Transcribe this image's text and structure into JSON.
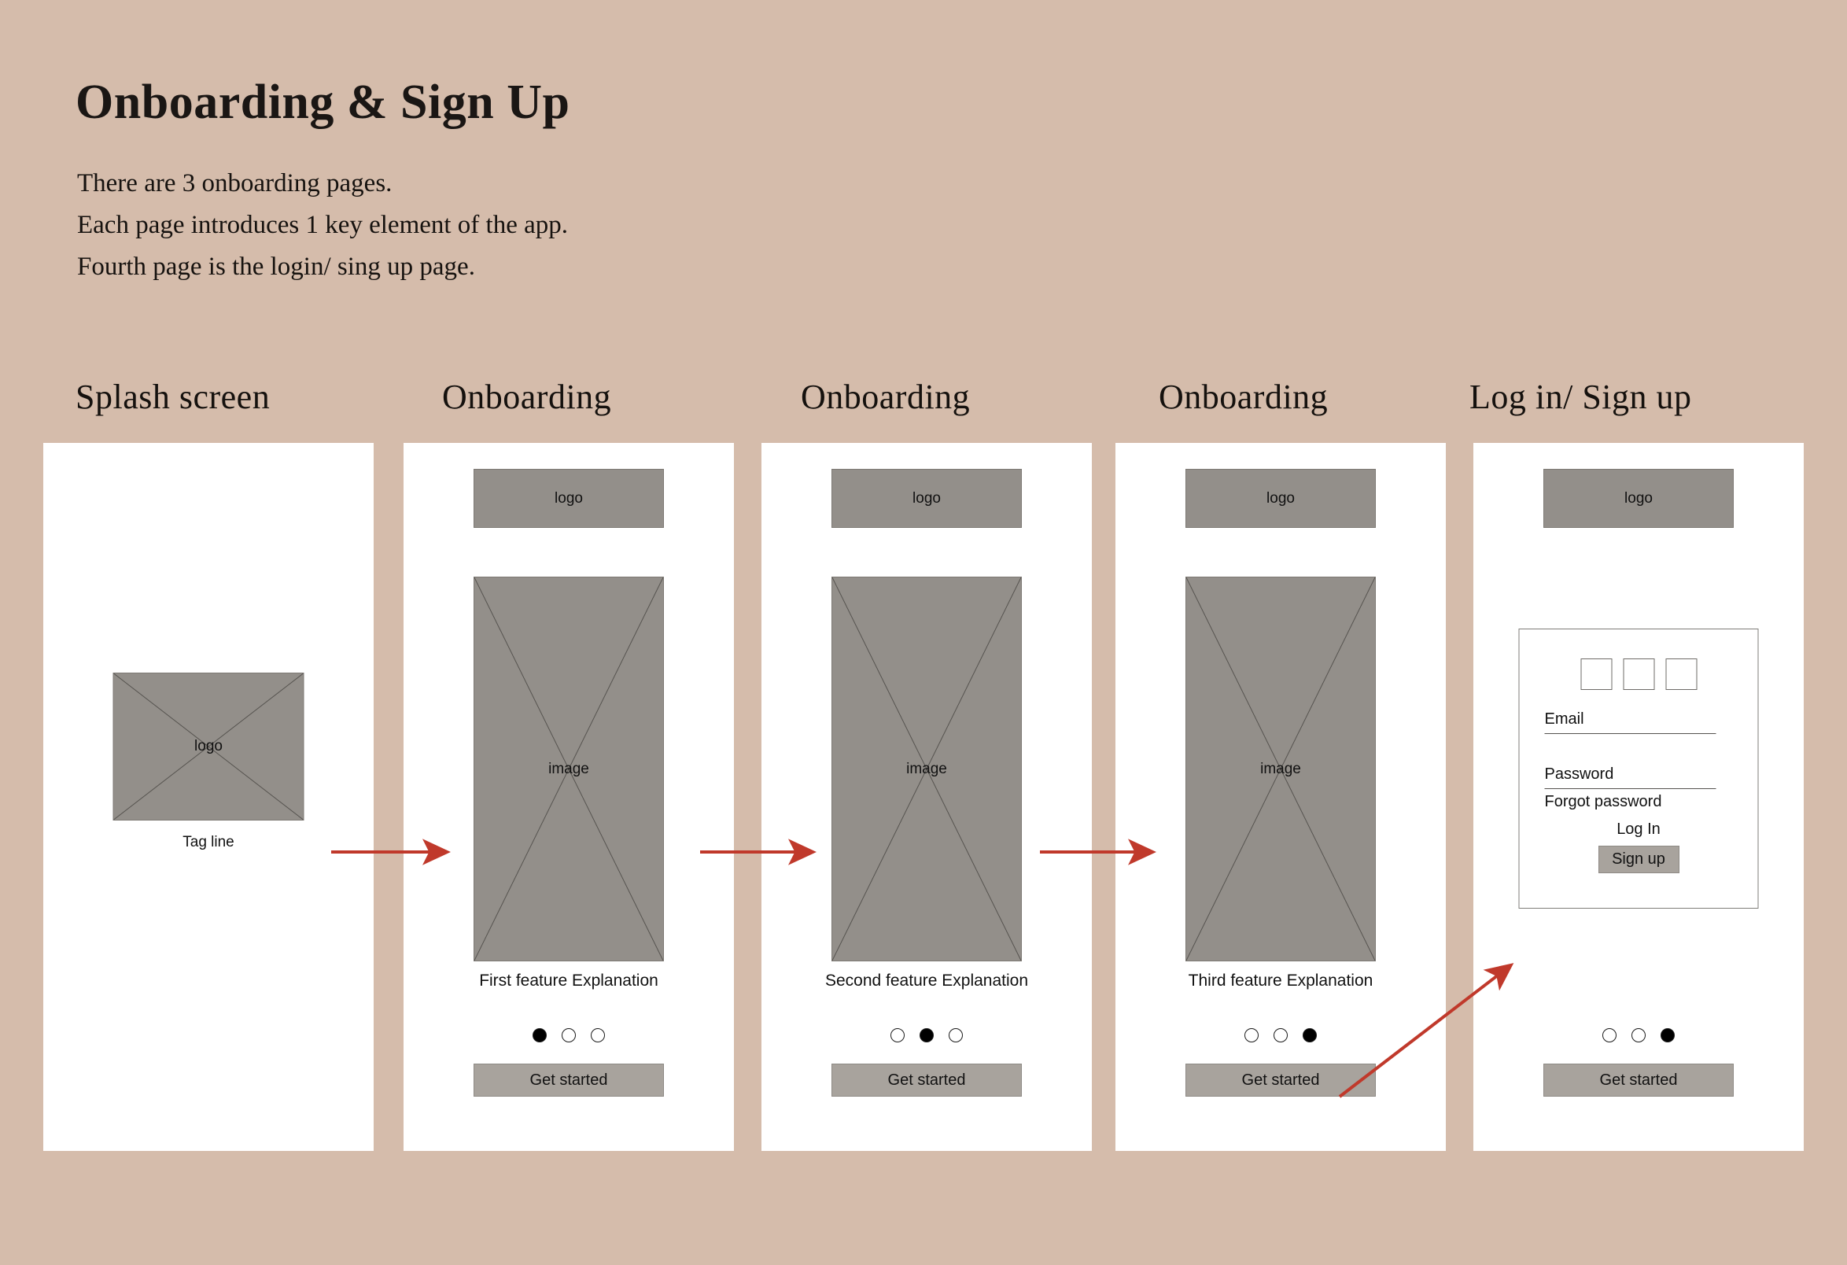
{
  "header": {
    "title": "Onboarding & Sign Up",
    "description_lines": [
      "There are 3 onboarding pages.",
      "Each page introduces 1 key element of the app.",
      "Fourth page is the login/ sing up page."
    ]
  },
  "colors": {
    "background": "#d5bcab",
    "card": "#ffffff",
    "placeholder_gray": "#938f8a",
    "button_gray": "#a8a39d",
    "arrow_red": "#c0392b",
    "text": "#111111"
  },
  "columns": [
    {
      "heading": "Splash screen"
    },
    {
      "heading": "Onboarding"
    },
    {
      "heading": "Onboarding"
    },
    {
      "heading": "Onboarding"
    },
    {
      "heading": "Log in/ Sign up"
    }
  ],
  "screens": {
    "splash": {
      "logo_label": "logo",
      "tagline": "Tag line"
    },
    "onboarding_1": {
      "logo_label": "logo",
      "image_label": "image",
      "feature_text": "First feature Explanation",
      "dots": [
        true,
        false,
        false
      ],
      "cta_label": "Get started"
    },
    "onboarding_2": {
      "logo_label": "logo",
      "image_label": "image",
      "feature_text": "Second feature Explanation",
      "dots": [
        false,
        true,
        false
      ],
      "cta_label": "Get started"
    },
    "onboarding_3": {
      "logo_label": "logo",
      "image_label": "image",
      "feature_text": "Third feature Explanation",
      "dots": [
        false,
        false,
        true
      ],
      "cta_label": "Get started"
    },
    "login": {
      "logo_label": "logo",
      "social_boxes": 3,
      "email_label": "Email",
      "password_label": "Password",
      "forgot_label": "Forgot password",
      "login_label": "Log In",
      "signup_label": "Sign up",
      "dots": [
        false,
        false,
        true
      ],
      "cta_label": "Get started"
    }
  },
  "flow_arrows": [
    {
      "name": "splash-to-onboarding-1"
    },
    {
      "name": "onboarding-1-to-onboarding-2"
    },
    {
      "name": "onboarding-2-to-onboarding-3"
    },
    {
      "name": "onboarding-3-to-login"
    }
  ]
}
